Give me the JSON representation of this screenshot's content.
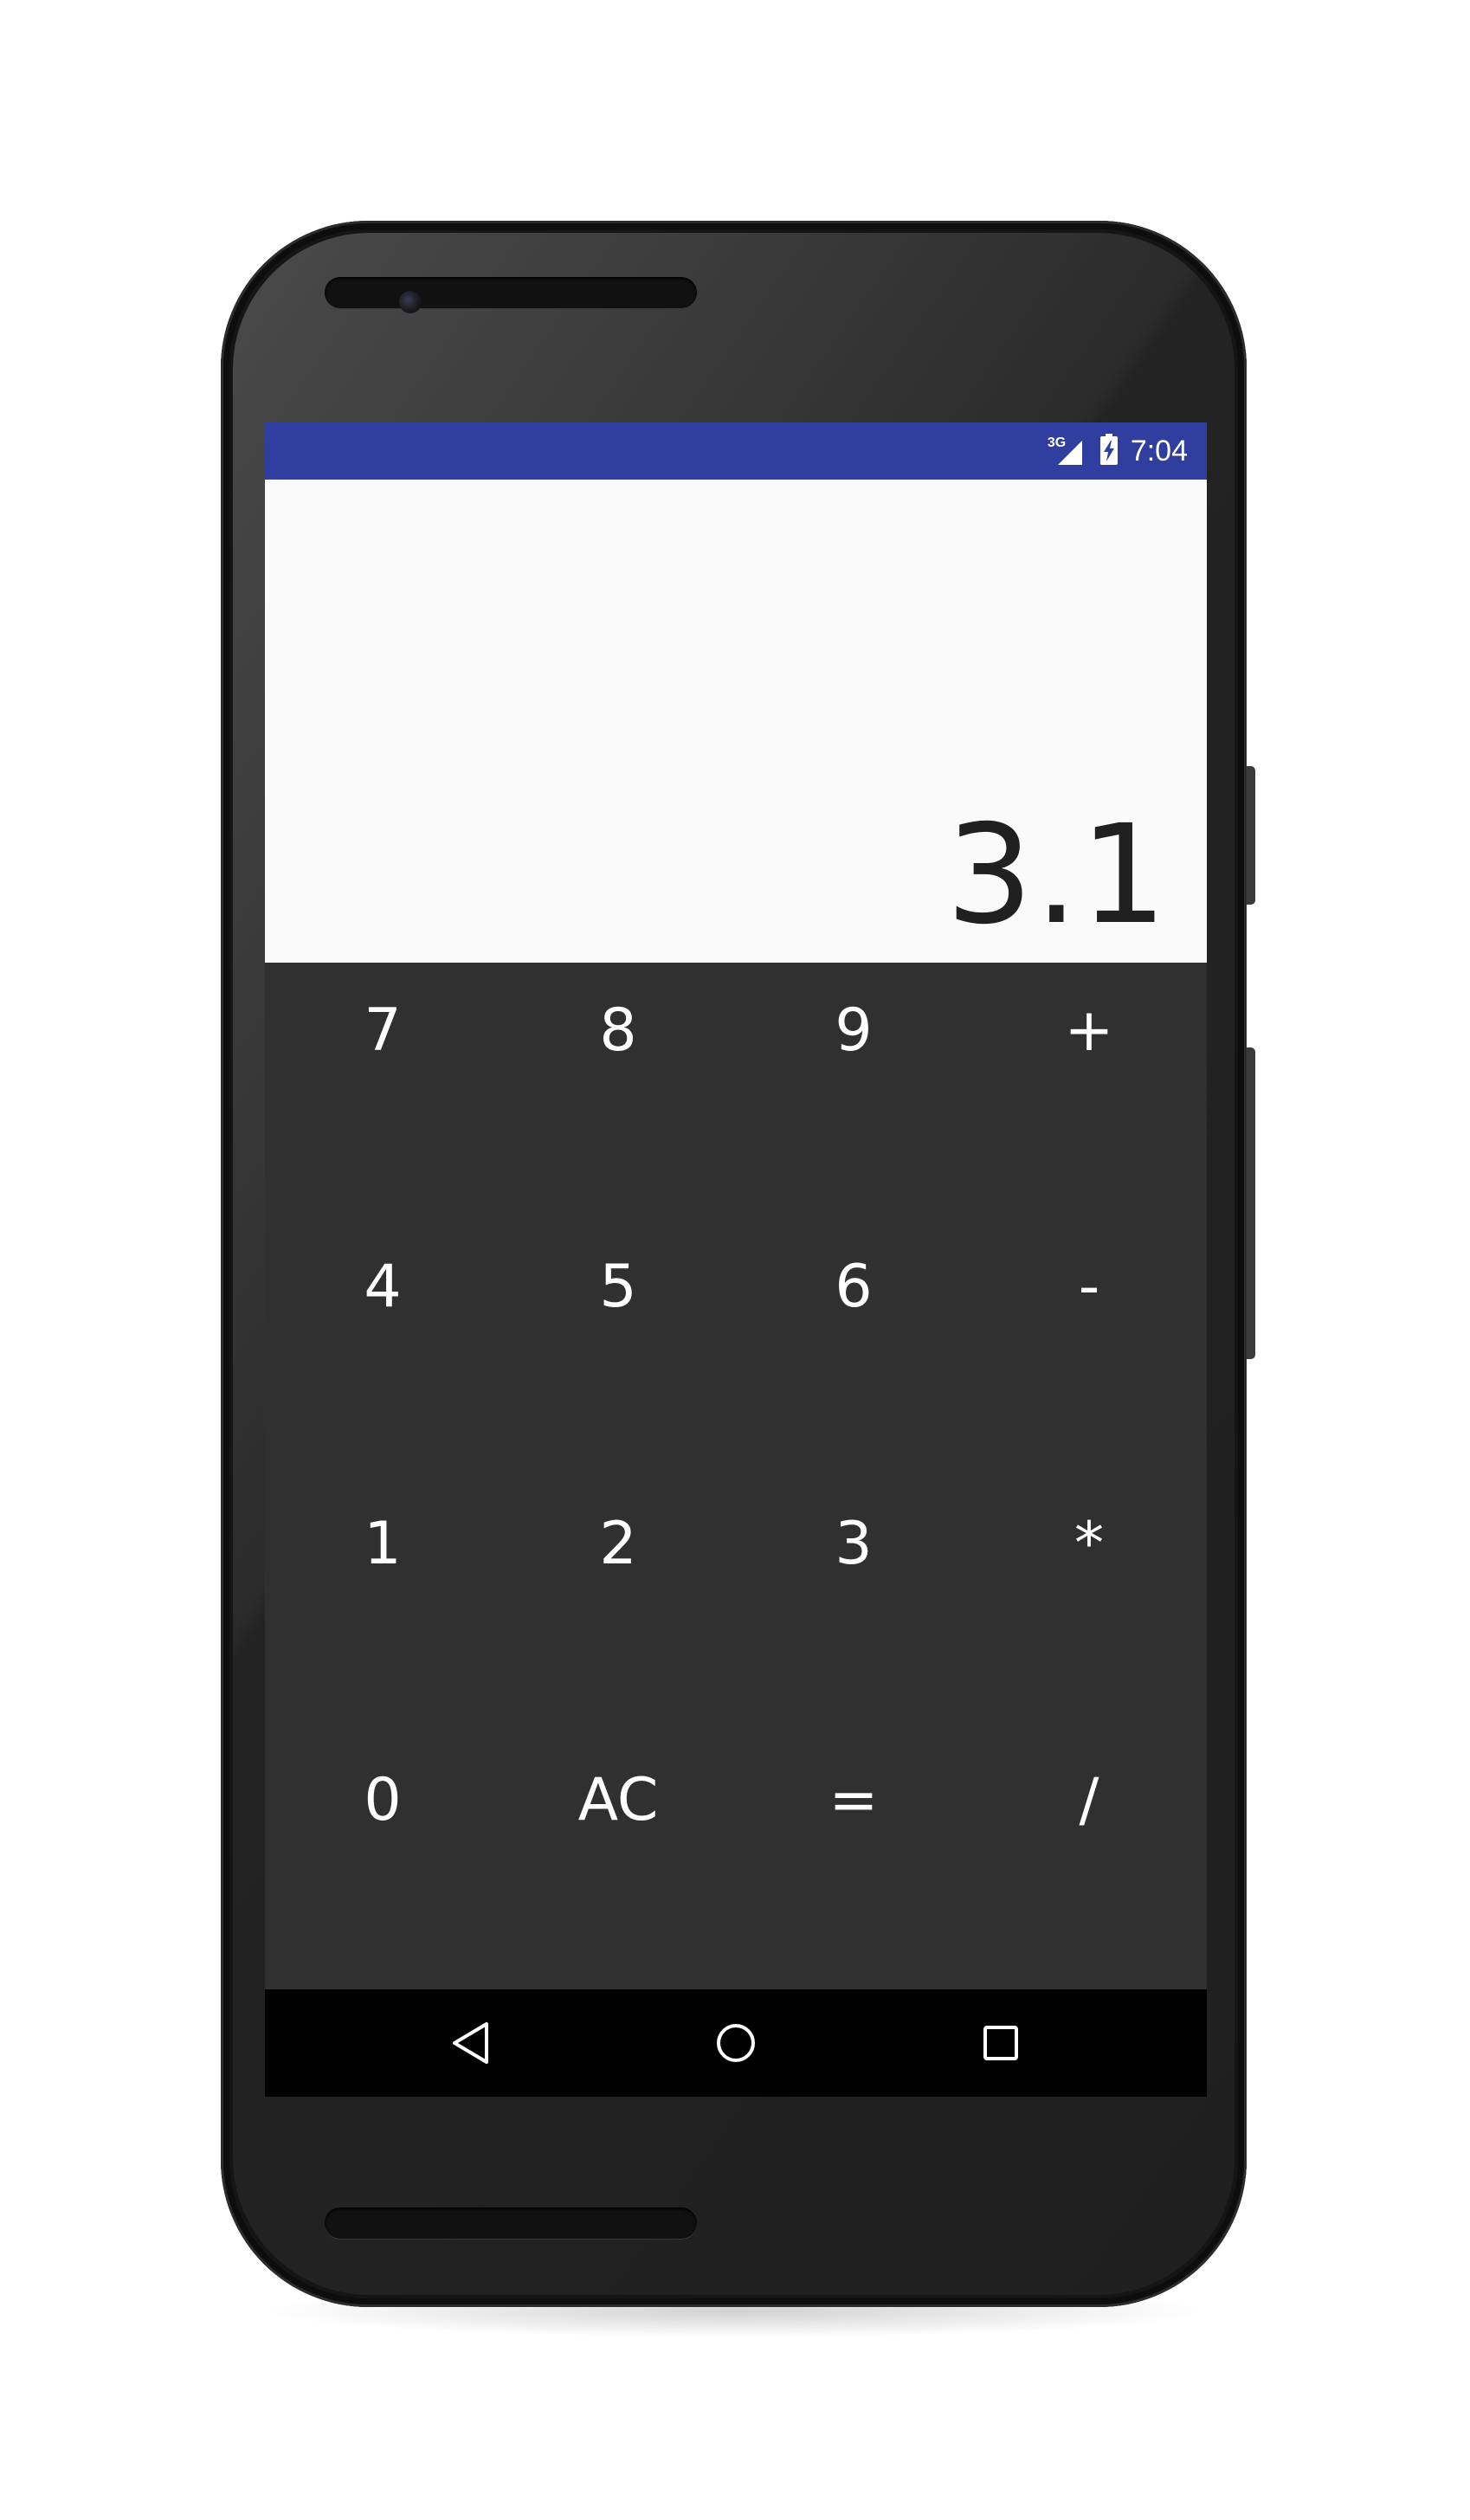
{
  "status_bar": {
    "network_type": "3G",
    "time": "7:04",
    "color": "#303f9f",
    "icons": [
      "signal-icon",
      "battery-charging-icon"
    ]
  },
  "display": {
    "value": "3.1"
  },
  "keypad": {
    "keys": [
      "7",
      "8",
      "9",
      "+",
      "4",
      "5",
      "6",
      "-",
      "1",
      "2",
      "3",
      "*",
      "0",
      "AC",
      "=",
      "/"
    ],
    "background": "#303030",
    "text_color": "#ffffff"
  },
  "nav_bar": {
    "buttons": [
      "back-icon",
      "home-icon",
      "recents-icon"
    ]
  }
}
